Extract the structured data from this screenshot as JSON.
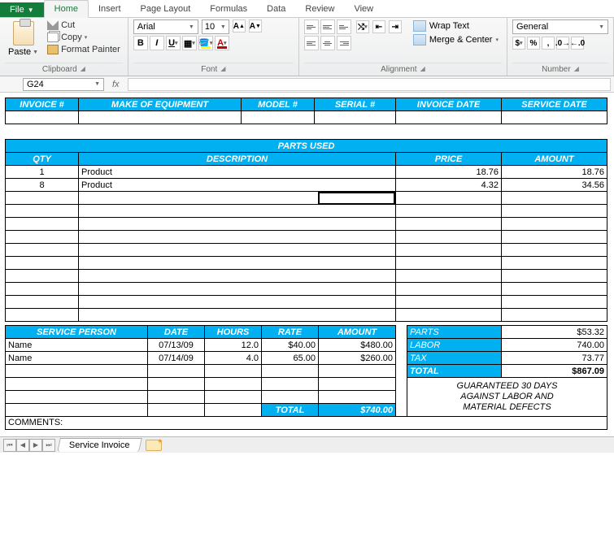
{
  "ribbon": {
    "file": "File",
    "tabs": [
      "Home",
      "Insert",
      "Page Layout",
      "Formulas",
      "Data",
      "Review",
      "View"
    ],
    "clipboard": {
      "paste": "Paste",
      "cut": "Cut",
      "copy": "Copy",
      "format_painter": "Format Painter",
      "label": "Clipboard"
    },
    "font": {
      "name": "Arial",
      "size": "10",
      "label": "Font"
    },
    "alignment": {
      "wrap": "Wrap Text",
      "merge": "Merge & Center",
      "label": "Alignment"
    },
    "number": {
      "format": "General",
      "label": "Number"
    }
  },
  "namebox": "G24",
  "fx_label": "fx",
  "invoice_header": {
    "cols": [
      "INVOICE #",
      "MAKE OF EQUIPMENT",
      "MODEL #",
      "SERIAL #",
      "INVOICE DATE",
      "SERVICE DATE"
    ]
  },
  "parts": {
    "title": "PARTS USED",
    "cols": [
      "QTY",
      "DESCRIPTION",
      "PRICE",
      "AMOUNT"
    ],
    "rows": [
      {
        "qty": "1",
        "desc": "Product",
        "price": "18.76",
        "amount": "18.76"
      },
      {
        "qty": "8",
        "desc": "Product",
        "price": "4.32",
        "amount": "34.56"
      }
    ]
  },
  "service": {
    "cols": [
      "SERVICE PERSON",
      "DATE",
      "HOURS",
      "RATE",
      "AMOUNT"
    ],
    "rows": [
      {
        "person": "Name",
        "date": "07/13/09",
        "hours": "12.0",
        "rate": "$40.00",
        "amount": "$480.00"
      },
      {
        "person": "Name",
        "date": "07/14/09",
        "hours": "4.0",
        "rate": "65.00",
        "amount": "$260.00"
      }
    ],
    "total_label": "TOTAL",
    "total": "$740.00"
  },
  "summary": {
    "parts_label": "PARTS",
    "parts": "$53.32",
    "labor_label": "LABOR",
    "labor": "740.00",
    "tax_label": "TAX",
    "tax": "73.77",
    "total_label": "TOTAL",
    "total": "$867.09"
  },
  "guarantee": {
    "l1": "GUARANTEED 30 DAYS",
    "l2": "AGAINST LABOR AND",
    "l3": "MATERIAL DEFECTS"
  },
  "comments_label": "COMMENTS:",
  "sheet_tab": "Service Invoice"
}
